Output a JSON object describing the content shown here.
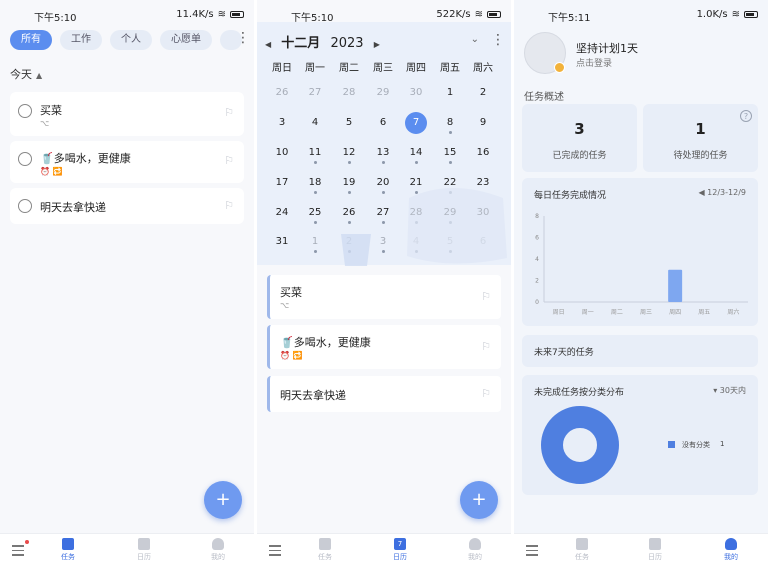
{
  "status_bars": [
    {
      "time": "下午5:10",
      "speed": "11.4K/s"
    },
    {
      "time": "下午5:10",
      "speed": "522K/s"
    },
    {
      "time": "下午5:11",
      "speed": "1.0K/s"
    }
  ],
  "filters": [
    "所有",
    "工作",
    "个人",
    "心愿单"
  ],
  "section_today": "今天",
  "tasks": [
    {
      "title": "买菜",
      "meta": "⌥"
    },
    {
      "title": "🥤多喝水，更健康",
      "meta": "⏰ 🔁"
    },
    {
      "title": "明天去拿快递",
      "meta": ""
    }
  ],
  "fab_label": "+",
  "tabs": {
    "tasks": "任务",
    "calendar": "日历",
    "calendar_icon_day": "7",
    "mine": "我的"
  },
  "calendar": {
    "month": "十二月",
    "year": "2023",
    "weekdays": [
      "周日",
      "周一",
      "周二",
      "周三",
      "周四",
      "周五",
      "周六"
    ],
    "rows": [
      [
        {
          "d": "26",
          "m": true
        },
        {
          "d": "27",
          "m": true
        },
        {
          "d": "28",
          "m": true
        },
        {
          "d": "29",
          "m": true
        },
        {
          "d": "30",
          "m": true
        },
        {
          "d": "1"
        },
        {
          "d": "2"
        }
      ],
      [
        {
          "d": "3"
        },
        {
          "d": "4"
        },
        {
          "d": "5"
        },
        {
          "d": "6"
        },
        {
          "d": "7",
          "today": true
        },
        {
          "d": "8",
          "dot": true
        },
        {
          "d": "9"
        }
      ],
      [
        {
          "d": "10"
        },
        {
          "d": "11",
          "dot": true
        },
        {
          "d": "12",
          "dot": true
        },
        {
          "d": "13",
          "dot": true
        },
        {
          "d": "14",
          "dot": true
        },
        {
          "d": "15",
          "dot": true
        },
        {
          "d": "16"
        }
      ],
      [
        {
          "d": "17"
        },
        {
          "d": "18",
          "dot": true
        },
        {
          "d": "19",
          "dot": true
        },
        {
          "d": "20",
          "dot": true
        },
        {
          "d": "21",
          "dot": true
        },
        {
          "d": "22",
          "dot": true
        },
        {
          "d": "23"
        }
      ],
      [
        {
          "d": "24"
        },
        {
          "d": "25",
          "dot": true
        },
        {
          "d": "26",
          "dot": true
        },
        {
          "d": "27",
          "dot": true
        },
        {
          "d": "28",
          "dot": true
        },
        {
          "d": "29",
          "dot": true
        },
        {
          "d": "30"
        }
      ],
      [
        {
          "d": "31"
        },
        {
          "d": "1",
          "m": true,
          "dot": true
        },
        {
          "d": "2",
          "m": true,
          "dot": true
        },
        {
          "d": "3",
          "m": true,
          "dot": true
        },
        {
          "d": "4",
          "m": true,
          "dot": true
        },
        {
          "d": "5",
          "m": true,
          "dot": true
        },
        {
          "d": "6",
          "m": true
        }
      ]
    ]
  },
  "profile": {
    "name": "坚持计划1天",
    "login": "点击登录",
    "overview_label": "任务概述",
    "completed_count": "3",
    "completed_label": "已完成的任务",
    "pending_count": "1",
    "pending_label": "待处理的任务",
    "help": "?",
    "daily_title": "每日任务完成情况",
    "daily_range": "◀ 12/3-12/9",
    "next7_title": "未来7天的任务",
    "dist_title": "未完成任务按分类分布",
    "dist_range": "▾ 30天内",
    "legend_label": "没有分类",
    "legend_value": "1"
  },
  "chart_data": [
    {
      "type": "bar",
      "title": "每日任务完成情况",
      "categories": [
        "周日",
        "周一",
        "周二",
        "周三",
        "周四",
        "周五",
        "周六"
      ],
      "values": [
        0,
        0,
        0,
        0,
        3,
        0,
        0
      ],
      "yticks": [
        "0",
        "2",
        "4",
        "6",
        "8"
      ],
      "ylim": [
        0,
        8
      ],
      "color": "#7ea7f0"
    },
    {
      "type": "pie",
      "title": "未完成任务按分类分布",
      "labels": [
        "没有分类"
      ],
      "values": [
        1
      ],
      "donut": true,
      "color": "#4f7fe0"
    }
  ]
}
